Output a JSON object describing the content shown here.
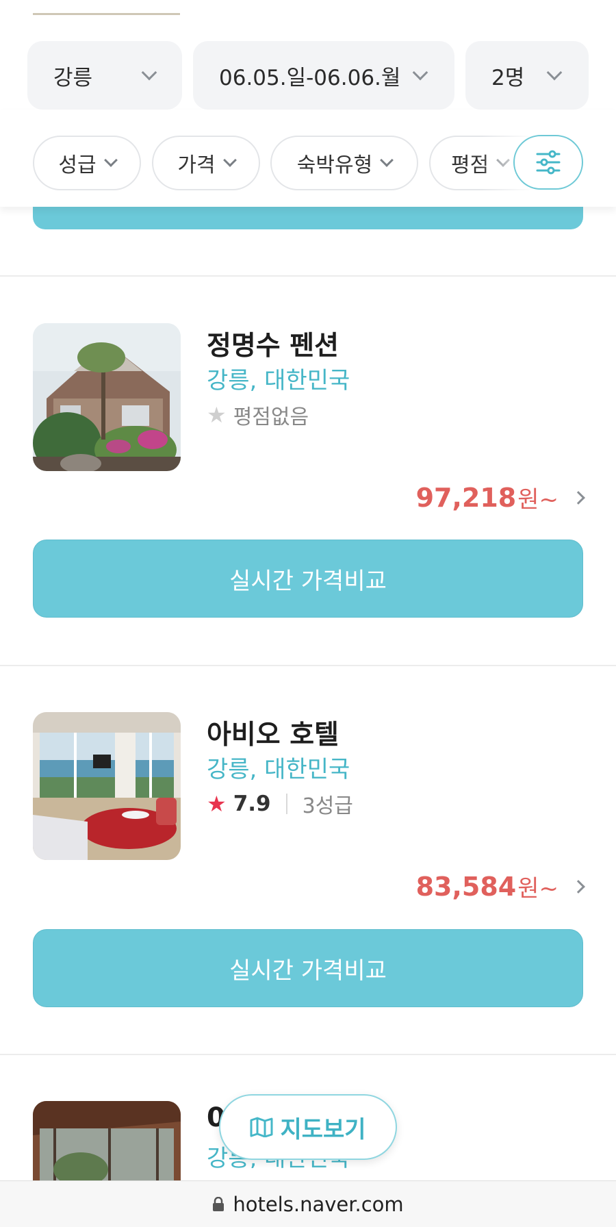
{
  "search": {
    "location": "강릉",
    "dates": "06.05.일-06.06.월",
    "guests": "2명"
  },
  "filters": {
    "chips": [
      "성급",
      "가격",
      "숙박유형",
      "평점"
    ]
  },
  "hotels": [
    {
      "name": "정명수 펜션",
      "location": "강릉, 대한민국",
      "rating_text": "평점없음",
      "price": "97,218",
      "currency": "원~",
      "button": "실시간 가격비교"
    },
    {
      "name": "아비오 호텔",
      "location": "강릉, 대한민국",
      "rating": "7.9",
      "stars_text": "3성급",
      "price": "83,584",
      "currency": "원~",
      "button": "실시간 가격비교"
    },
    {
      "name": "0",
      "location": "강릉, 대한민국"
    }
  ],
  "map_button": {
    "label": "지도보기"
  },
  "browser": {
    "url": "hotels.naver.com"
  },
  "colors": {
    "accent": "#6bc9d9",
    "price": "#e0605c",
    "location": "#46b6c7",
    "star_rated": "#e8344e",
    "star_empty": "#cfcfcf"
  }
}
